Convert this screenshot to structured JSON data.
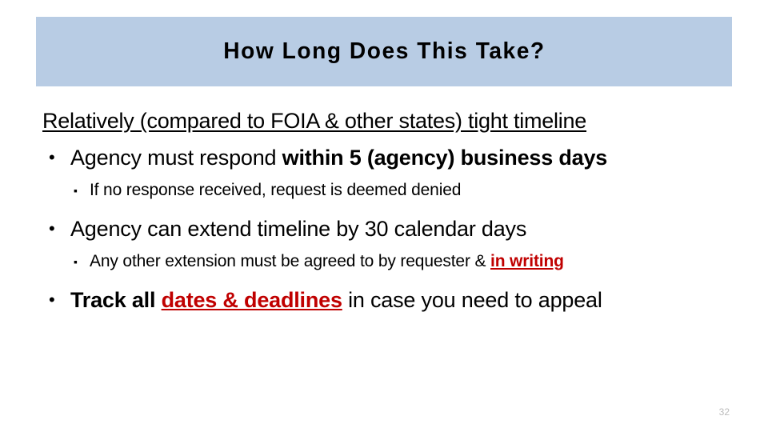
{
  "slide": {
    "title": "How Long Does This Take?",
    "page_number": "32",
    "band_color": "#b8cce4",
    "accent_red": "#c00000",
    "text_color": "#000000",
    "page_number_color": "#bcbcbc"
  },
  "content": {
    "lead": {
      "text": "Relatively (compared to FOIA & other states) tight timeline",
      "style": "underline"
    },
    "bullets": [
      {
        "level": 1,
        "marker": "•",
        "segments": [
          {
            "text": "Agency must respond ",
            "style": "normal"
          },
          {
            "text": "within 5 (agency) business days",
            "style": "bold"
          }
        ]
      },
      {
        "level": 2,
        "marker": "▪",
        "segments": [
          {
            "text": "If no response received, request is deemed denied",
            "style": "normal"
          }
        ]
      },
      {
        "level": 1,
        "marker": "•",
        "segments": [
          {
            "text": "Agency can extend timeline by 30 calendar days",
            "style": "normal"
          }
        ]
      },
      {
        "level": 2,
        "marker": "▪",
        "segments": [
          {
            "text": "Any other extension must be agreed to by requester & ",
            "style": "normal"
          },
          {
            "text": "in writing",
            "style": "bold-red-underline"
          }
        ]
      },
      {
        "level": 1,
        "marker": "•",
        "segments": [
          {
            "text": "Track all ",
            "style": "bold"
          },
          {
            "text": "dates & deadlines",
            "style": "bold-red-underline"
          },
          {
            "text": " in case you need to appeal",
            "style": "normal"
          }
        ]
      }
    ]
  }
}
